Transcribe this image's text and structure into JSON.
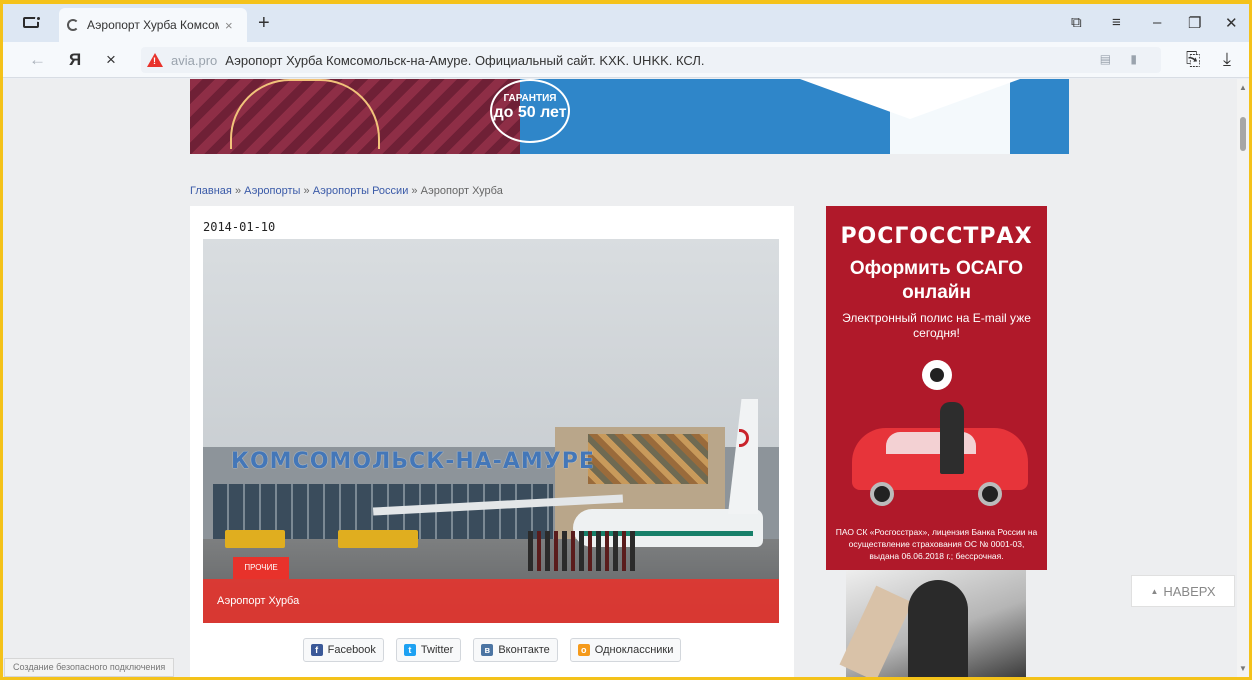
{
  "browser": {
    "tab_title": "Аэропорт Хурба Комсомо",
    "tab_close": "×",
    "new_tab": "+",
    "domain": "avia.pro",
    "page_title": "Аэропорт Хурба Комсомольск-на-Амуре. Официальный сайт. KXK. UHKK. КСЛ.",
    "yandex_logo": "Я",
    "stop": "×",
    "back": "←",
    "status": "Создание безопасного подключения"
  },
  "banner": {
    "guarantee_line1": "ГАРАНТИЯ",
    "guarantee_line2": "до 50 лет"
  },
  "breadcrumb": {
    "items": [
      "Главная",
      "Аэропорты",
      "Аэропорты России",
      "Аэропорт Хурба"
    ],
    "separator": "»"
  },
  "article": {
    "date": "2014-01-10",
    "photo_sign": "КОМСОМОЛЬСК-НА-АМУРЕ",
    "category": "ПРОЧИЕ",
    "caption": "Аэропорт Хурба"
  },
  "share": {
    "facebook": "Facebook",
    "twitter": "Twitter",
    "vk": "Вконтакте",
    "ok": "Одноклассники"
  },
  "ad": {
    "brand": "РОСГОССТРАХ",
    "headline": "Оформить ОСАГО онлайн",
    "subline": "Электронный полис на E-mail уже сегодня!",
    "legal": "ПАО СК «Росгосстрах», лицензия Банка России на осуществление страхования ОС № 0001-03, выдана 06.06.2018 г.; бессрочная.",
    "brand_color": "#b0192a"
  },
  "to_top": {
    "label": "НАВЕРХ"
  },
  "colors": {
    "accent_red": "#e8322b",
    "frame_yellow": "#f4c21a",
    "link_blue": "#3a5aa8"
  }
}
